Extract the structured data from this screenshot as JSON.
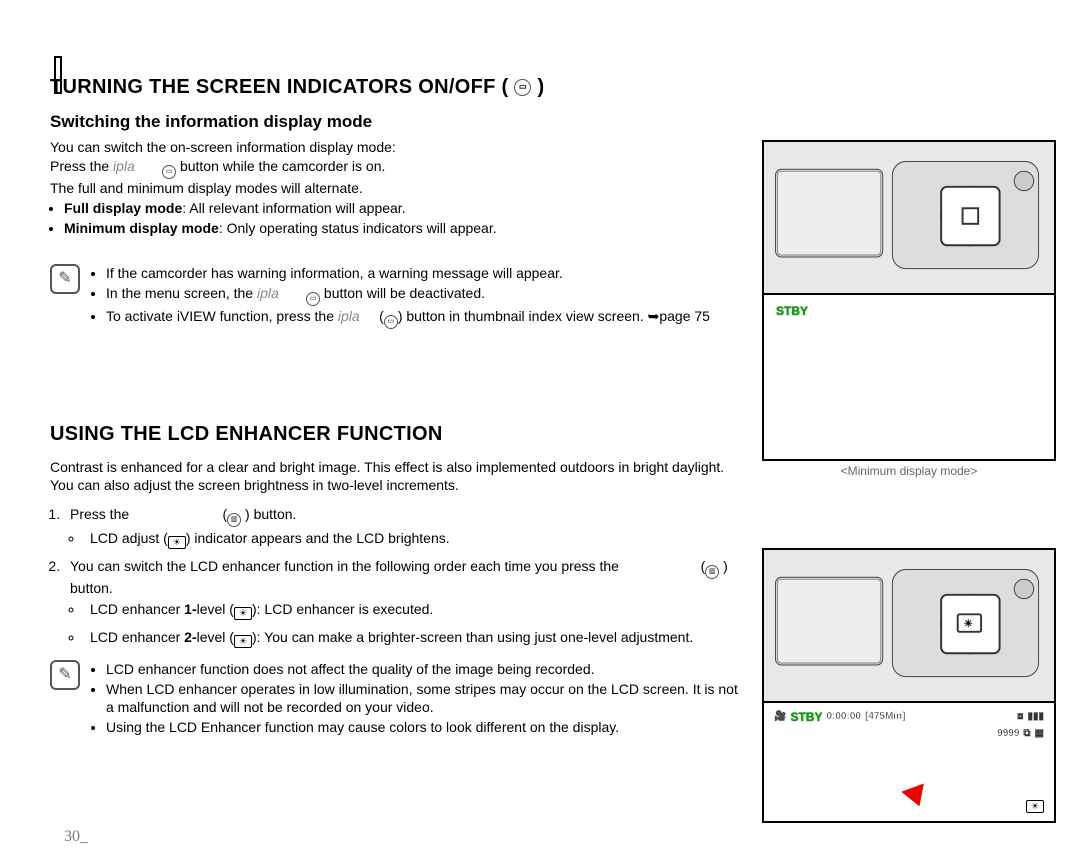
{
  "page_number": "30",
  "section1": {
    "title": "TURNING THE SCREEN INDICATORS ON/OFF (",
    "title_end": " )",
    "subtitle": "Switching the information display mode",
    "line1": "You can switch the on-screen information display mode:",
    "line2a": "Press the ",
    "line2b_grey": "ipla",
    "line2c": " button while the camcorder is on.",
    "line3": "The full and minimum display modes will alternate.",
    "bullet1_label": "Full display mode",
    "bullet1_text": ": All relevant information will appear.",
    "bullet2_label": "Minimum display mode",
    "bullet2_text": ": Only operating status indicators will appear.",
    "note1": "If the camcorder has warning information, a warning message will appear.",
    "note2a": "In the menu screen, the ",
    "note2b_grey": "ipla",
    "note2c": " button will be deactivated.",
    "note3a": "To activate iVIEW function, press the ",
    "note3b_grey": "ipla",
    "note3c": ") button in thumbnail index view screen. ➥page 75"
  },
  "right1": {
    "stby": "STBY",
    "caption": "<Minimum display mode>"
  },
  "section2": {
    "title": "USING THE LCD ENHANCER FUNCTION",
    "line1": "Contrast is enhanced for a clear and bright image. This effect is also implemented outdoors in bright daylight.",
    "line2": "You can also adjust the screen brightness in two-level increments.",
    "step1a": "Press the",
    "step1b": ") button.",
    "step1c": "LCD adjust (",
    "step1d": ") indicator appears and the LCD brightens.",
    "step2a": "You can switch the LCD enhancer function in the following order each time you press the",
    "step2b": ") button.",
    "step2c_pre": "LCD enhancer ",
    "step2c_bold": "1-",
    "step2c_post": "level (",
    "step2c_end": "): LCD enhancer is executed.",
    "step2d_pre": "LCD enhancer ",
    "step2d_bold": "2-",
    "step2d_post": "level (",
    "step2d_end": "): You can make a brighter-screen than using just one-level adjustment.",
    "note1": "LCD enhancer function does not affect the quality of the image being recorded.",
    "note2": "When LCD enhancer operates in low illumination, some stripes may occur on the LCD screen. It is not a malfunction and will not be recorded on your video.",
    "note3": "Using the LCD Enhancer function may cause colors to look different on the display."
  },
  "right2": {
    "stby": "STBY",
    "time": "0:00:00",
    "remain": "[475Min]",
    "count": "9999"
  }
}
